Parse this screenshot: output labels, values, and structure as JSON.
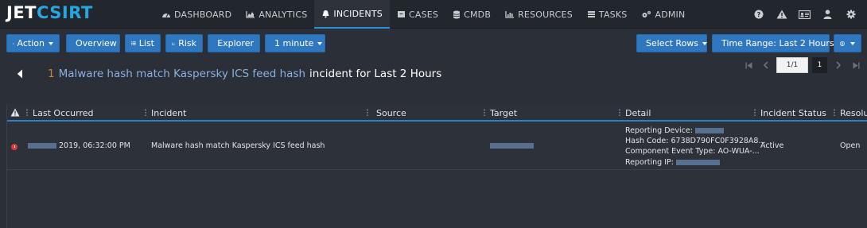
{
  "app": {
    "logo_a": "JET",
    "logo_b": "CSIRT"
  },
  "nav": [
    {
      "label": "DASHBOARD",
      "icon": "dashboard-icon",
      "active": false
    },
    {
      "label": "ANALYTICS",
      "icon": "area-chart-icon",
      "active": false
    },
    {
      "label": "INCIDENTS",
      "icon": "bell-icon",
      "active": true
    },
    {
      "label": "CASES",
      "icon": "case-icon",
      "active": false
    },
    {
      "label": "CMDB",
      "icon": "database-icon",
      "active": false
    },
    {
      "label": "RESOURCES",
      "icon": "bar-chart-icon",
      "active": false
    },
    {
      "label": "TASKS",
      "icon": "tasks-icon",
      "active": false
    },
    {
      "label": "ADMIN",
      "icon": "gears-icon",
      "active": false
    }
  ],
  "top_icons": [
    "help-icon",
    "warning-icon",
    "id-card-icon",
    "user-icon",
    "settings-icon"
  ],
  "toolbar": {
    "action": "Action",
    "overview": "Overview",
    "list": "List",
    "risk": "Risk",
    "explorer": "Explorer",
    "refresh": "1 minute",
    "select_rows": "Select Rows",
    "time_range": "Time Range: Last 2 Hours"
  },
  "header": {
    "count": "1",
    "incident_link": "Malware hash match Kaspersky ICS feed hash",
    "suffix": "incident for Last 2 Hours"
  },
  "pager": {
    "input": "1/1",
    "page": "1"
  },
  "table": {
    "columns": [
      "Last Occurred",
      "Incident",
      "Source",
      "Target",
      "Detail",
      "Incident Status",
      "Resolu"
    ],
    "rows": [
      {
        "severity": "high",
        "last_occurred": "2019, 06:32:00 PM",
        "incident": "Malware hash match Kaspersky ICS feed hash",
        "detail": {
          "reporting_device_label": "Reporting Device:",
          "hash_code": "Hash Code: 6738D790FC0F3928A8...",
          "component_event_type": "Component Event Type: AO-WUA-...",
          "reporting_ip_label": "Reporting IP:"
        },
        "status": "Active",
        "resolution": "Open"
      }
    ]
  },
  "colors": {
    "accent": "#2f78c0",
    "logo_accent": "#27a7e0",
    "severity_high": "#d93a3a",
    "link": "#8ab0e0"
  }
}
